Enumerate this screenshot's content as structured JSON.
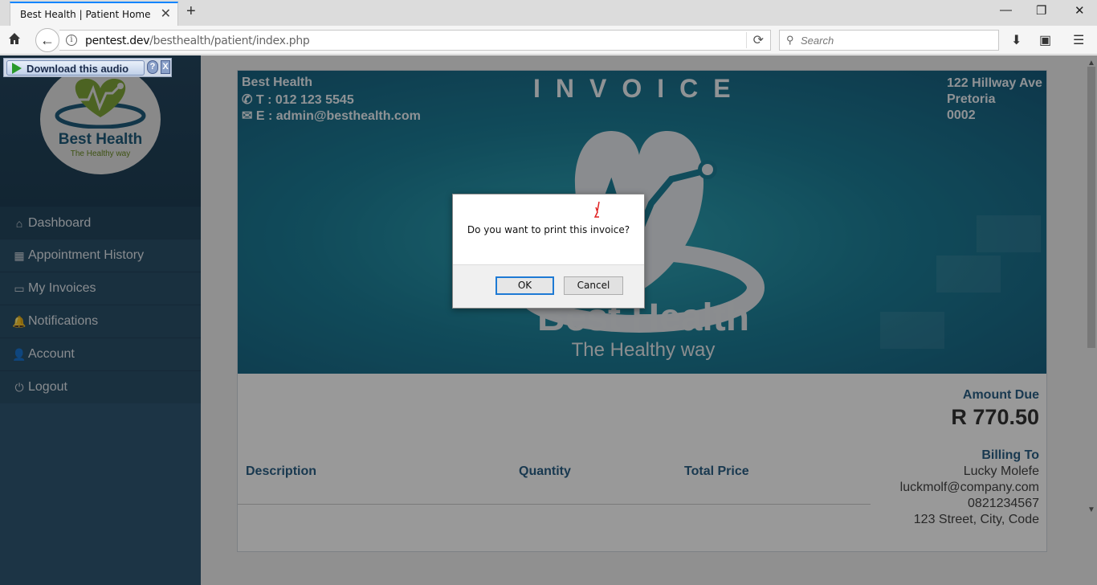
{
  "browser": {
    "tab_title": "Best Health | Patient Home",
    "url_domain": "pentest.dev",
    "url_path": "/besthealth/patient/index.php",
    "search_placeholder": "Search"
  },
  "download_bar": {
    "label": "Download this audio",
    "help": "?",
    "close": "X"
  },
  "sidebar": {
    "logo_name": "Best Health",
    "logo_tagline": "The Healthy way",
    "items": [
      {
        "label": "Dashboard",
        "icon": "home-icon",
        "glyph": "⌂"
      },
      {
        "label": "Appointment History",
        "icon": "calendar-icon",
        "glyph": "▦"
      },
      {
        "label": "My Invoices",
        "icon": "credit-card-icon",
        "glyph": "▭"
      },
      {
        "label": "Notifications",
        "icon": "bell-icon",
        "glyph": "🔔"
      },
      {
        "label": "Account",
        "icon": "user-icon",
        "glyph": "👤"
      },
      {
        "label": "Logout",
        "icon": "power-icon",
        "glyph": "⏻"
      }
    ]
  },
  "invoice": {
    "company": "Best Health",
    "phone": "T : 012 123 5545",
    "email": "E : admin@besthealth.com",
    "title": "INVOICE",
    "address": [
      "122 Hillway Ave",
      "Pretoria",
      "0002"
    ],
    "banner_name": "Best Health",
    "banner_tagline": "The Healthy way",
    "amount_due_label": "Amount Due",
    "amount_due": "R 770.50",
    "billing_to_label": "Billing To",
    "billing": [
      "Lucky Molefe",
      "luckmolf@company.com",
      "0821234567",
      "123 Street, City, Code"
    ],
    "columns": [
      "Description",
      "Quantity",
      "Total Price"
    ]
  },
  "dialog": {
    "message": "Do you want to print this invoice?",
    "ok_label": "OK",
    "cancel_label": "Cancel"
  },
  "colors": {
    "sidebar": "#2a4d6a",
    "accent": "#2a5f85",
    "banner": "#1d7f98",
    "focus": "#1e7ad4"
  }
}
